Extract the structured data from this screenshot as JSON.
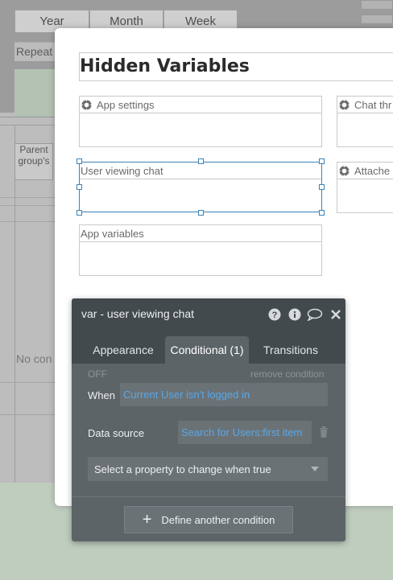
{
  "background": {
    "segments": [
      "Year",
      "Month",
      "Week"
    ],
    "repeat_label": "Repeat",
    "parent_group_label": "Parent group's",
    "no_content_label": "No con"
  },
  "popup": {
    "title": "Hidden Variables",
    "groups": {
      "app_settings": "App settings",
      "chat_thread": "Chat thr",
      "user_viewing_chat": "User viewing chat",
      "attached": "Attache",
      "app_variables": "App variables"
    }
  },
  "editor": {
    "title": "var - user viewing chat",
    "tabs": [
      "Appearance",
      "Conditional (1)",
      "Transitions"
    ],
    "active_tab": "Conditional (1)",
    "off_label": "OFF",
    "remove_condition": "remove condition",
    "when_label": "When",
    "when_value": "Current User isn't logged in",
    "data_source_label": "Data source",
    "data_source_value": "Search for Users:first item",
    "property_select": "Select a property to change when true",
    "define_button": "Define another condition",
    "icons": [
      "help-icon",
      "info-icon",
      "comment-icon",
      "close-icon",
      "trash-icon",
      "chevron-down-icon",
      "plus-icon",
      "gear-icon"
    ]
  },
  "colors": {
    "editor_bg": "#5d6467",
    "editor_header": "#434a4d",
    "link_blue": "#5ba7e6",
    "selection_blue": "#3a83b8"
  }
}
